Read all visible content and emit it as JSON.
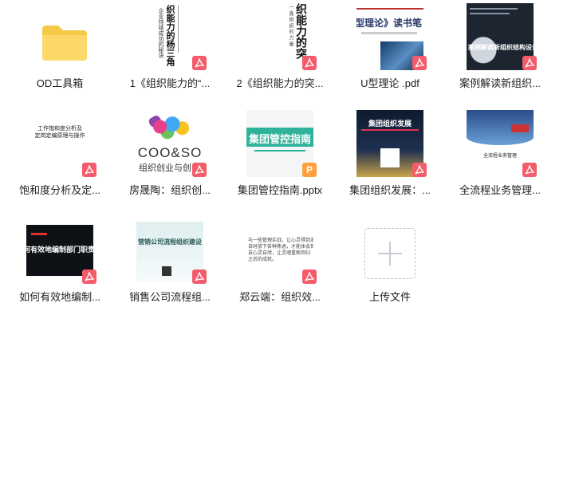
{
  "files": [
    {
      "name": "OD工具箱",
      "type": "folder"
    },
    {
      "name": "1《组织能力的“...",
      "type": "pdf",
      "thumb": {
        "lines": [
          "织能力的杨三角",
          "企业持续成功的秘诀"
        ],
        "bg": "#ffffff"
      }
    },
    {
      "name": "2《组织能力的突...",
      "type": "pdf",
      "thumb": {
        "lines": [
          "织能力的突",
          "一 鑫 组 织 的 力 量"
        ],
        "bg": "#ffffff"
      }
    },
    {
      "name": "U型理论 .pdf",
      "type": "pdf",
      "thumb": {
        "title": "型理论》读书笔",
        "bg": "#ffffff"
      }
    },
    {
      "name": "案例解读新组织...",
      "type": "pdf",
      "thumb": {
        "title": "案例解读新组织结构设计",
        "bg": "#1c2530"
      }
    },
    {
      "name": "饱和度分析及定...",
      "type": "pdf",
      "thumb": {
        "lines": [
          "工作饱和度分析及",
          "定岗定编原理与操作"
        ],
        "bg": "#ffffff"
      }
    },
    {
      "name": "房晟陶：组织创...",
      "type": "pdf",
      "thumb": {
        "title": "COO&SO",
        "sub": "组织创业与创",
        "bg": "#ffffff"
      }
    },
    {
      "name": "集团管控指南.pptx",
      "type": "ppt",
      "thumb": {
        "title": "集团管控指南",
        "bg": "#ffffff"
      }
    },
    {
      "name": "集团组织发展：...",
      "type": "pdf",
      "thumb": {
        "title": "集团组织发展",
        "bg": "#0f1a2e"
      }
    },
    {
      "name": "全流程业务管理...",
      "type": "pdf",
      "thumb": {
        "title": "全流程业务管理",
        "bg": "#ffffff"
      }
    },
    {
      "name": "如何有效地编制...",
      "type": "pdf",
      "thumb": {
        "title": "何有效地编制部门职责",
        "bg": "#0e1116"
      }
    },
    {
      "name": "销售公司流程组...",
      "type": "pdf",
      "thumb": {
        "title": "营销公司流程组织建设",
        "bg": "#dfeef0"
      }
    },
    {
      "name": "郑云端：组织效...",
      "type": "pdf",
      "thumb": {
        "lines": [
          "与一些管理实战，让心灵得到滋养，",
          "自时放下各种焦虑，才能体会到做",
          "自心灵自然，让灵魂重新回归",
          "之后的成就。"
        ],
        "bg": "#ffffff"
      }
    },
    {
      "name": "上传文件",
      "type": "upload"
    }
  ],
  "icons": {
    "pdf": "pdf-icon",
    "ppt": "ppt-icon",
    "folder": "folder-icon",
    "upload": "plus-icon"
  },
  "ppt_badge_letter": "P"
}
